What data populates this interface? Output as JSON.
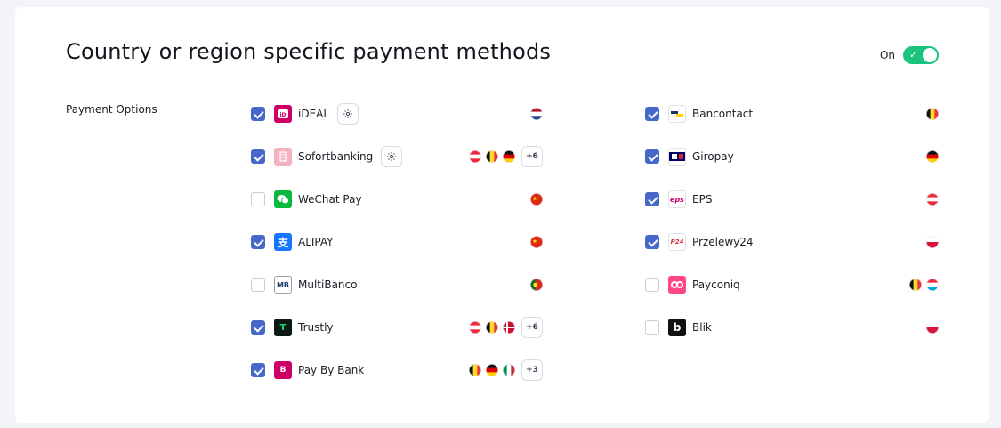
{
  "header": {
    "title": "Country or region specific payment methods",
    "toggle_label": "On",
    "toggle_state": "on",
    "toggle_color": "#1bc47d"
  },
  "section_label": "Payment Options",
  "accent_color": "#4668c9",
  "left_methods": [
    {
      "name": "iDEAL",
      "checked": true,
      "logo": "ideal-logo",
      "settings": true,
      "flags": [
        "NL"
      ],
      "more": ""
    },
    {
      "name": "Sofortbanking",
      "checked": true,
      "logo": "sofort-logo",
      "settings": true,
      "flags": [
        "AT",
        "BE",
        "DE"
      ],
      "more": "+6"
    },
    {
      "name": "WeChat Pay",
      "checked": false,
      "logo": "wechat-logo",
      "settings": false,
      "flags": [
        "CN"
      ],
      "more": ""
    },
    {
      "name": "ALIPAY",
      "checked": true,
      "logo": "alipay-logo",
      "settings": false,
      "flags": [
        "CN"
      ],
      "more": ""
    },
    {
      "name": "MultiBanco",
      "checked": false,
      "logo": "multibanco-logo",
      "settings": false,
      "flags": [
        "PT"
      ],
      "more": ""
    },
    {
      "name": "Trustly",
      "checked": true,
      "logo": "trustly-logo",
      "settings": false,
      "flags": [
        "AT",
        "BE",
        "DK"
      ],
      "more": "+6"
    },
    {
      "name": "Pay By Bank",
      "checked": true,
      "logo": "paybybank-logo",
      "settings": false,
      "flags": [
        "BE",
        "DE",
        "IT"
      ],
      "more": "+3"
    }
  ],
  "right_methods": [
    {
      "name": "Bancontact",
      "checked": true,
      "logo": "bancontact-logo",
      "settings": false,
      "flags": [
        "BE"
      ],
      "more": ""
    },
    {
      "name": "Giropay",
      "checked": true,
      "logo": "giropay-logo",
      "settings": false,
      "flags": [
        "DE"
      ],
      "more": ""
    },
    {
      "name": "EPS",
      "checked": true,
      "logo": "eps-logo",
      "settings": false,
      "flags": [
        "AT"
      ],
      "more": ""
    },
    {
      "name": "Przelewy24",
      "checked": true,
      "logo": "przelewy24-logo",
      "settings": false,
      "flags": [
        "PL"
      ],
      "more": ""
    },
    {
      "name": "Payconiq",
      "checked": false,
      "logo": "payconiq-logo",
      "settings": false,
      "flags": [
        "BE",
        "LU"
      ],
      "more": ""
    },
    {
      "name": "Blik",
      "checked": false,
      "logo": "blik-logo",
      "settings": false,
      "flags": [
        "PL"
      ],
      "more": ""
    }
  ]
}
